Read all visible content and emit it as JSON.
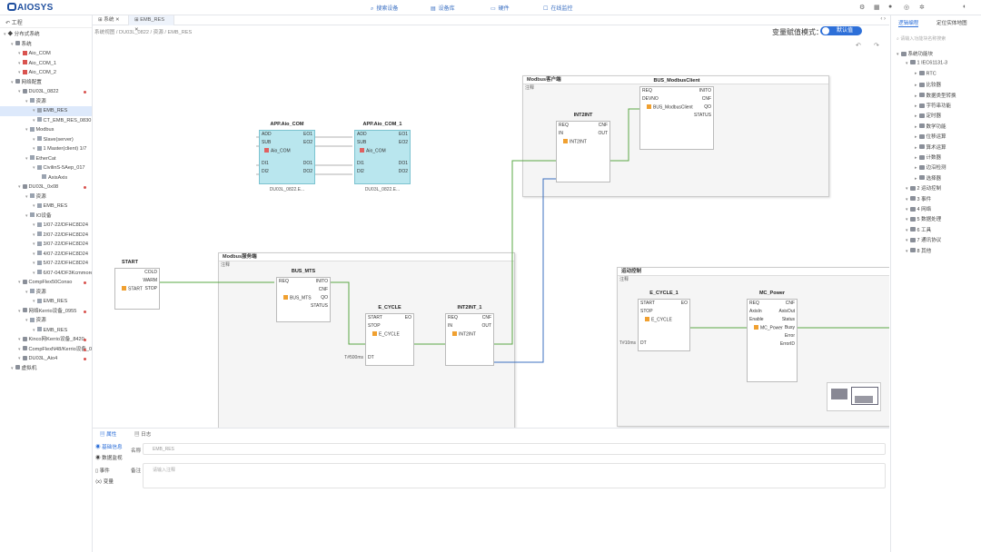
{
  "app": {
    "logo": "AIOSYS"
  },
  "toolbar": {
    "items": [
      {
        "icon": "search-icon",
        "label": "搜索设备"
      },
      {
        "icon": "device-icon",
        "label": "设备库"
      },
      {
        "icon": "doc-icon",
        "label": "硬件"
      },
      {
        "icon": "monitor-icon",
        "label": "在线监控"
      }
    ]
  },
  "left_panel": {
    "title": "工程",
    "tree": [
      {
        "label": "◆ 分布式系统",
        "level": 0,
        "icon": "none"
      },
      {
        "label": "系统",
        "level": 1,
        "icon": "dev"
      },
      {
        "label": "Aio_COM",
        "level": 2,
        "icon": "red"
      },
      {
        "label": "Aio_COM_1",
        "level": 2,
        "icon": "red"
      },
      {
        "label": "Aio_COM_2",
        "level": 2,
        "icon": "red"
      },
      {
        "label": "网络配置",
        "level": 1,
        "icon": "dev"
      },
      {
        "label": "DU03L_0822",
        "level": 2,
        "icon": "dev",
        "dot": true
      },
      {
        "label": "资源",
        "level": 3,
        "icon": "doc"
      },
      {
        "label": "EMB_RES",
        "level": 4,
        "icon": "doc",
        "selected": true
      },
      {
        "label": "CT_EMB_RES_0830",
        "level": 4,
        "icon": "doc"
      },
      {
        "label": "Modbus",
        "level": 3,
        "icon": "doc"
      },
      {
        "label": "Slave(server)",
        "level": 4,
        "icon": "doc"
      },
      {
        "label": "1 Master(client) 1/7",
        "level": 4,
        "icon": "doc"
      },
      {
        "label": "EtherCat",
        "level": 3,
        "icon": "doc"
      },
      {
        "label": "CivilinS-5Aep_017",
        "level": 4,
        "icon": "doc"
      },
      {
        "label": "AxisAxis",
        "level": 5,
        "icon": "doc"
      },
      {
        "label": "DU03L_0x08",
        "level": 2,
        "icon": "dev",
        "dot": true
      },
      {
        "label": "资源",
        "level": 3,
        "icon": "doc"
      },
      {
        "label": "EMB_RES",
        "level": 4,
        "icon": "doc"
      },
      {
        "label": "IO设备",
        "level": 3,
        "icon": "doc"
      },
      {
        "label": "1/07-22/DFHC8D24",
        "level": 4,
        "icon": "doc"
      },
      {
        "label": "2/07-22/DFHC8D24",
        "level": 4,
        "icon": "doc"
      },
      {
        "label": "3/07-22/DFHC8D24",
        "level": 4,
        "icon": "doc"
      },
      {
        "label": "4/07-22/DFHC8D24",
        "level": 4,
        "icon": "doc"
      },
      {
        "label": "5/07-22/DFHC8D24",
        "level": 4,
        "icon": "doc"
      },
      {
        "label": "6/07-04/DF3Kcmmore",
        "level": 4,
        "icon": "doc"
      },
      {
        "label": "CompFlex50Conso",
        "level": 2,
        "icon": "dev",
        "dot": true
      },
      {
        "label": "资源",
        "level": 3,
        "icon": "doc"
      },
      {
        "label": "EMB_RES",
        "level": 4,
        "icon": "doc"
      },
      {
        "label": "网络Kerrio设备_0955",
        "level": 2,
        "icon": "dev",
        "dot": true
      },
      {
        "label": "资源",
        "level": 3,
        "icon": "doc"
      },
      {
        "label": "EMB_RES",
        "level": 4,
        "icon": "doc"
      },
      {
        "label": "Kinco网Kerrio设备_8420",
        "level": 2,
        "icon": "dev",
        "dot": true
      },
      {
        "label": "CompFlexN48/Kerrio设备_0556",
        "level": 2,
        "icon": "dev",
        "dot": true
      },
      {
        "label": "DU03L_Aio4",
        "level": 2,
        "icon": "dev",
        "dot": true
      },
      {
        "label": "虚拟机",
        "level": 1,
        "icon": "dev"
      }
    ]
  },
  "tabs": [
    {
      "label": "系统",
      "active": false
    },
    {
      "label": "EMB_RES",
      "active": true
    }
  ],
  "breadcrumb": "系统视图  /  DU03L_0822  /  资源  /  EMB_RES",
  "toggle": {
    "label": "变量赋值模式：",
    "value": "默认值"
  },
  "groups": [
    {
      "title": "Modbus客户端",
      "subtitle": "注释"
    },
    {
      "title": "Modbus服务端",
      "subtitle": "注释"
    },
    {
      "title": "运动控制",
      "subtitle": "注释"
    }
  ],
  "blocks": {
    "app_aio_com": {
      "title": "APP.Aio_COM",
      "bottom": "DU03L_0822.E...",
      "inputs": [
        "ADD",
        "SUB"
      ],
      "outputs": [
        "EO1",
        "EO2"
      ],
      "inner": "Aio_COM",
      "di": [
        "DI1",
        "DI2"
      ],
      "do": [
        "DO1",
        "DO2"
      ]
    },
    "app_aio_com_1": {
      "title": "APP.Aio_COM_1",
      "bottom": "DU03L_0822.E...",
      "inputs": [
        "ADD",
        "SUB"
      ],
      "outputs": [
        "EO1",
        "EO2"
      ],
      "inner": "Aio_COM",
      "di": [
        "DI1",
        "DI2"
      ],
      "do": [
        "DO1",
        "DO2"
      ]
    },
    "start": {
      "title": "START",
      "outputs": [
        "COLD",
        "WARM",
        "STOP"
      ],
      "inner": "START"
    },
    "bus_mts": {
      "title": "BUS_MTS",
      "inputs": [
        "REQ"
      ],
      "outputs": [
        "INITO",
        "CNF",
        "QO",
        "STATUS"
      ],
      "inner": "BUS_MTS"
    },
    "e_cycle": {
      "title": "E_CYCLE",
      "inputs": [
        "START",
        "STOP"
      ],
      "outputs": [
        "EO"
      ],
      "inner": "E_CYCLE",
      "dt_label": "DT",
      "dt_value": "T#500ms"
    },
    "int2int_1": {
      "title": "INT2INT_1",
      "inputs": [
        "REQ",
        "IN"
      ],
      "outputs": [
        "CNF",
        "OUT"
      ],
      "inner": "INT2INT"
    },
    "int2int": {
      "title": "INT2INT",
      "inputs": [
        "REQ",
        "IN"
      ],
      "outputs": [
        "CNF",
        "OUT"
      ],
      "inner": "INT2INT"
    },
    "bus_client": {
      "title": "BUS_ModbusClient",
      "inputs": [
        "REQ",
        "DEVNO"
      ],
      "outputs": [
        "INITO",
        "CNF",
        "QO",
        "STATUS"
      ],
      "inner": "BUS_ModbusClient"
    },
    "e_cycle_1": {
      "title": "E_CYCLE_1",
      "inputs": [
        "START",
        "STOP"
      ],
      "outputs": [
        "EO"
      ],
      "inner": "E_CYCLE",
      "dt_label": "DT",
      "dt_value": "T#10ms"
    },
    "mc_power": {
      "title": "MC_Power",
      "inputs": [
        "REQ",
        "AxisIn",
        "Enable"
      ],
      "outputs": [
        "CNF",
        "AxisOut",
        "Status",
        "Busy",
        "Error",
        "ErrorID"
      ],
      "inner": "MC_Power"
    }
  },
  "bottom": {
    "tabs": [
      "属性",
      "日志"
    ],
    "side": [
      "基础信息",
      "数据监视",
      "事件",
      "变量"
    ],
    "name_label": "名称 *",
    "name_value": "EMB_RES",
    "note_label": "备注",
    "note_placeholder": "请输入注释"
  },
  "right_panel": {
    "tabs": [
      "逻辑编程",
      "定位实体地图"
    ],
    "search_placeholder": "请输入功能块名称搜索",
    "tree": [
      {
        "label": "系统功能块",
        "level": 0
      },
      {
        "label": "1 IEC61131-3",
        "level": 1
      },
      {
        "label": "RTC",
        "level": 2
      },
      {
        "label": "比较器",
        "level": 2
      },
      {
        "label": "数据类型转换",
        "level": 2
      },
      {
        "label": "字符串功能",
        "level": 2
      },
      {
        "label": "定时器",
        "level": 2
      },
      {
        "label": "数学功能",
        "level": 2
      },
      {
        "label": "位移运算",
        "level": 2
      },
      {
        "label": "算术运算",
        "level": 2
      },
      {
        "label": "计数器",
        "level": 2
      },
      {
        "label": "边沿检测",
        "level": 2
      },
      {
        "label": "选择器",
        "level": 2
      },
      {
        "label": "2 运动控制",
        "level": 1
      },
      {
        "label": "3 事件",
        "level": 1
      },
      {
        "label": "4 网络",
        "level": 1
      },
      {
        "label": "5 数据处理",
        "level": 1
      },
      {
        "label": "6 工具",
        "level": 1
      },
      {
        "label": "7 通讯协议",
        "level": 1
      },
      {
        "label": "8 其他",
        "level": 1
      }
    ]
  },
  "colors": {
    "accent": "#2d6fd8",
    "wire": "#5aa845",
    "teal": "#b9e6ee"
  }
}
